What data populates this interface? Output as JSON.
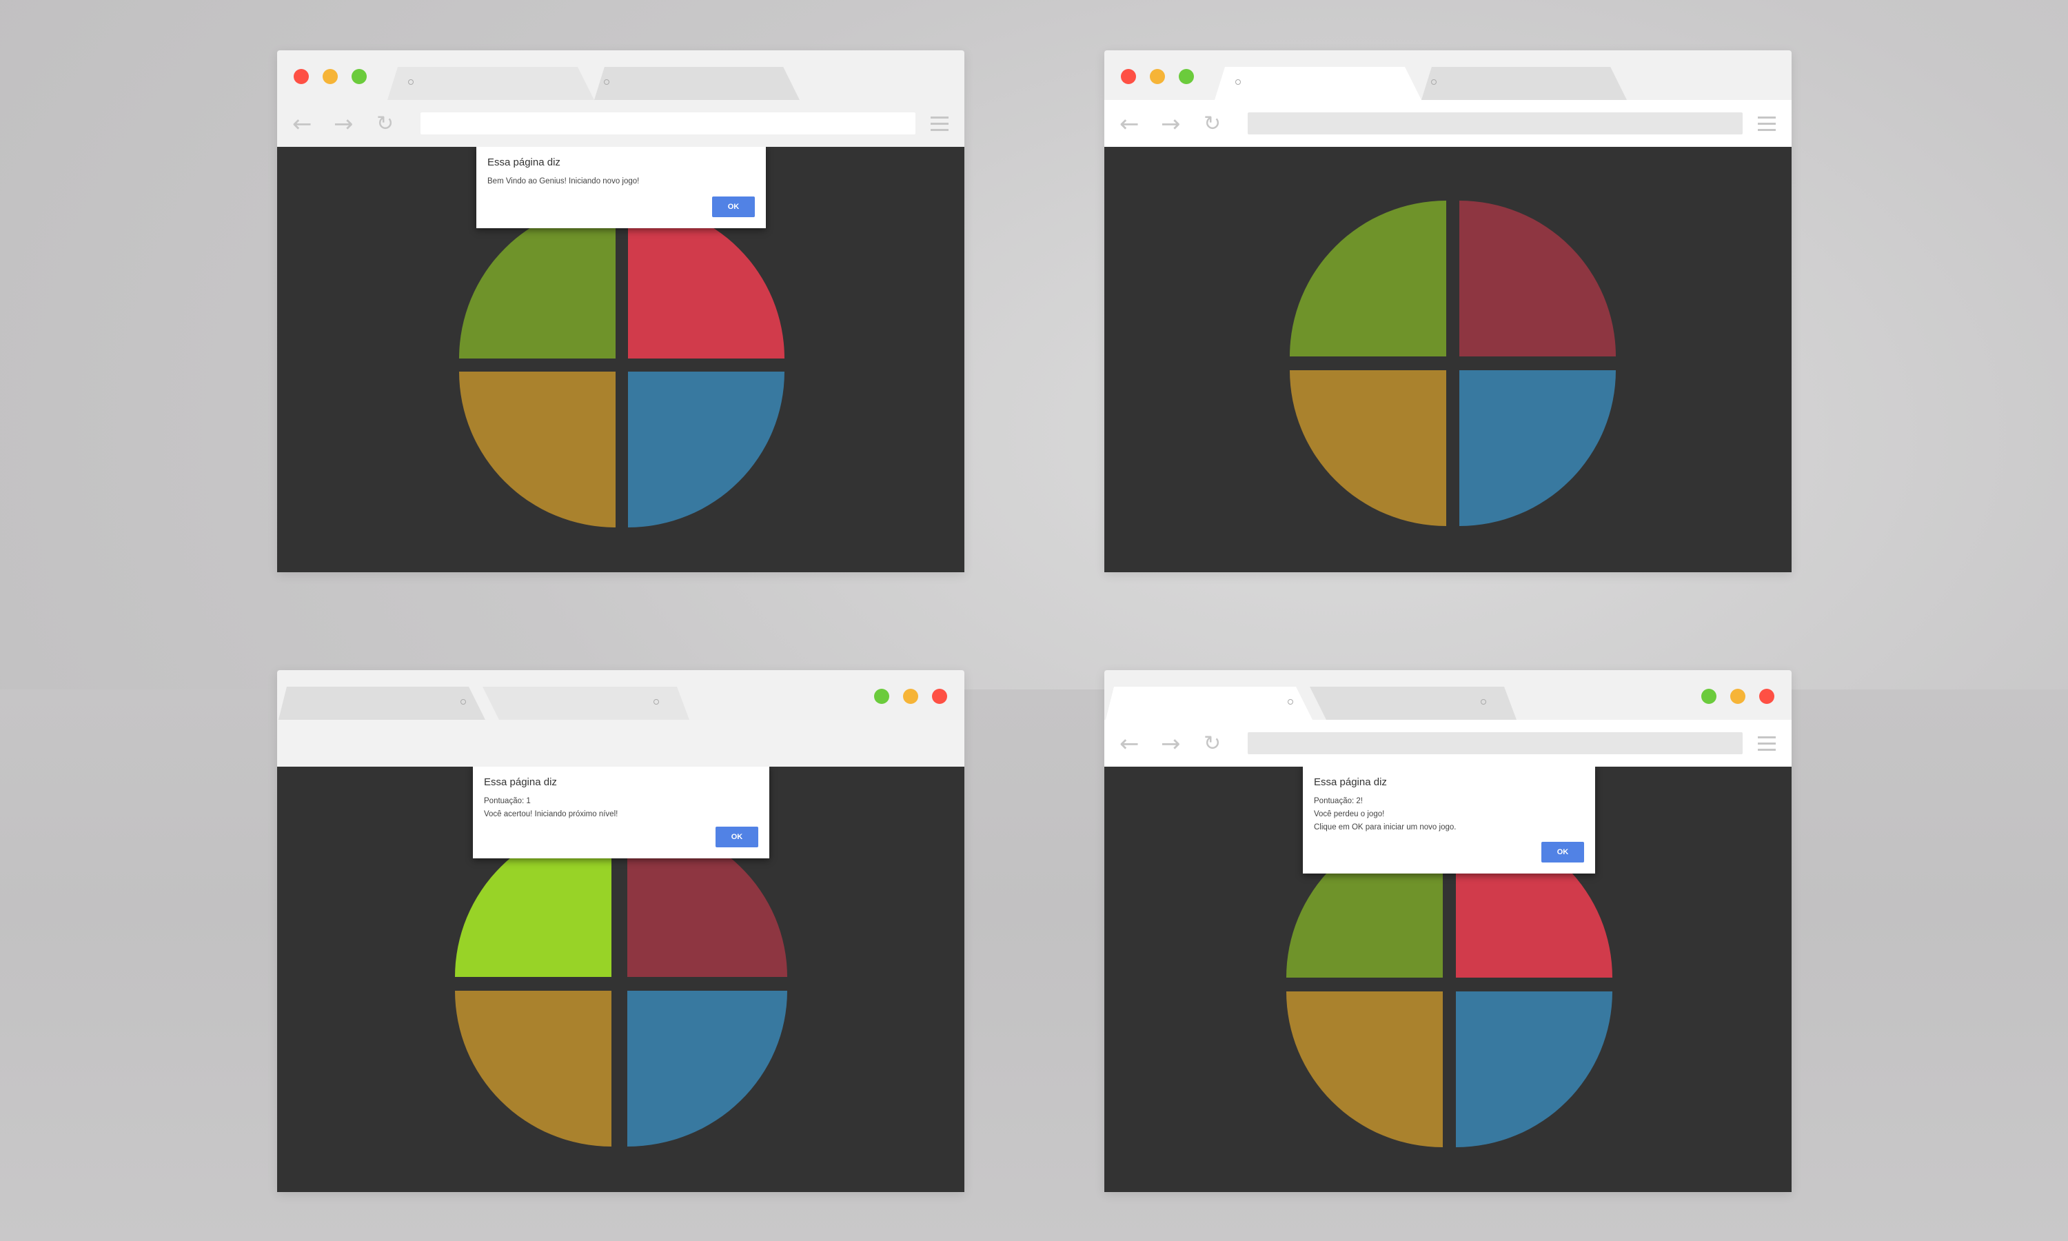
{
  "colors": {
    "background": "#c9c8c9",
    "game_bg": "#333333",
    "button_blue": "#5182e5",
    "green_normal": "#6f932a",
    "green_lit": "#98d327",
    "red_normal": "#d13b4b",
    "red_dim": "#8e3641",
    "yellow": "#aa822d",
    "blue": "#3879a0"
  },
  "screens": [
    {
      "dialog": {
        "title": "Essa página diz",
        "lines": [
          "Bem Vindo ao Genius! Iniciando novo jogo!"
        ],
        "ok_label": "OK"
      }
    },
    {
      "dialog": null
    },
    {
      "dialog": {
        "title": "Essa página diz",
        "lines": [
          "Pontuação: 1",
          "Você acertou! Iniciando próximo nível!"
        ],
        "ok_label": "OK"
      }
    },
    {
      "dialog": {
        "title": "Essa página diz",
        "lines": [
          "Pontuação: 2!",
          "Você perdeu o jogo!",
          "Clique em OK para iniciar um novo jogo."
        ],
        "ok_label": "OK"
      }
    }
  ]
}
